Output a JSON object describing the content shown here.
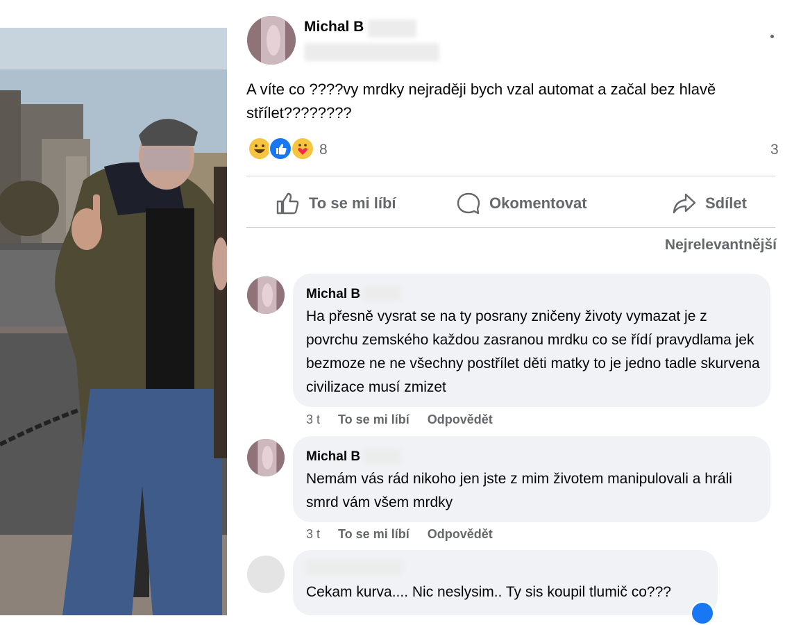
{
  "post": {
    "author": "Michal B",
    "text": "A víte co ????vy mrdky nejraději bych vzal automat a začal bez hlavě střílet????????",
    "reaction_icons": [
      "haha-icon",
      "like-icon",
      "care-icon"
    ],
    "reaction_count": "8",
    "comment_count": "3"
  },
  "actions": {
    "like": "To se mi líbí",
    "comment": "Okomentovat",
    "share": "Sdílet"
  },
  "sort_label": "Nejrelevantnější",
  "comments": [
    {
      "author": "Michal B",
      "text": "Ha přesně vysrat se na ty posrany zničeny životy vymazat je z povrchu zemského každou zasranou mrdku co se řídí pravydlama jek bezmoze ne ne všechny postřílet děti matky to je jedno tadle skurvena civilizace musí zmizet",
      "time": "3 t",
      "like_label": "To se mi líbí",
      "reply_label": "Odpovědět"
    },
    {
      "author": "Michal B",
      "text": "Nemám vás rád nikoho jen jste z mim životem manipulovali a hráli smrd vám všem mrdky",
      "time": "3 t",
      "like_label": "To se mi líbí",
      "reply_label": "Odpovědět"
    },
    {
      "author": "",
      "text": "Cekam kurva.... Nic neslysim.. Ty sis koupil tlumič co???"
    }
  ],
  "colors": {
    "like_blue": "#1877f2",
    "bubble_bg": "#f0f2f5",
    "secondary_text": "#65676b"
  }
}
